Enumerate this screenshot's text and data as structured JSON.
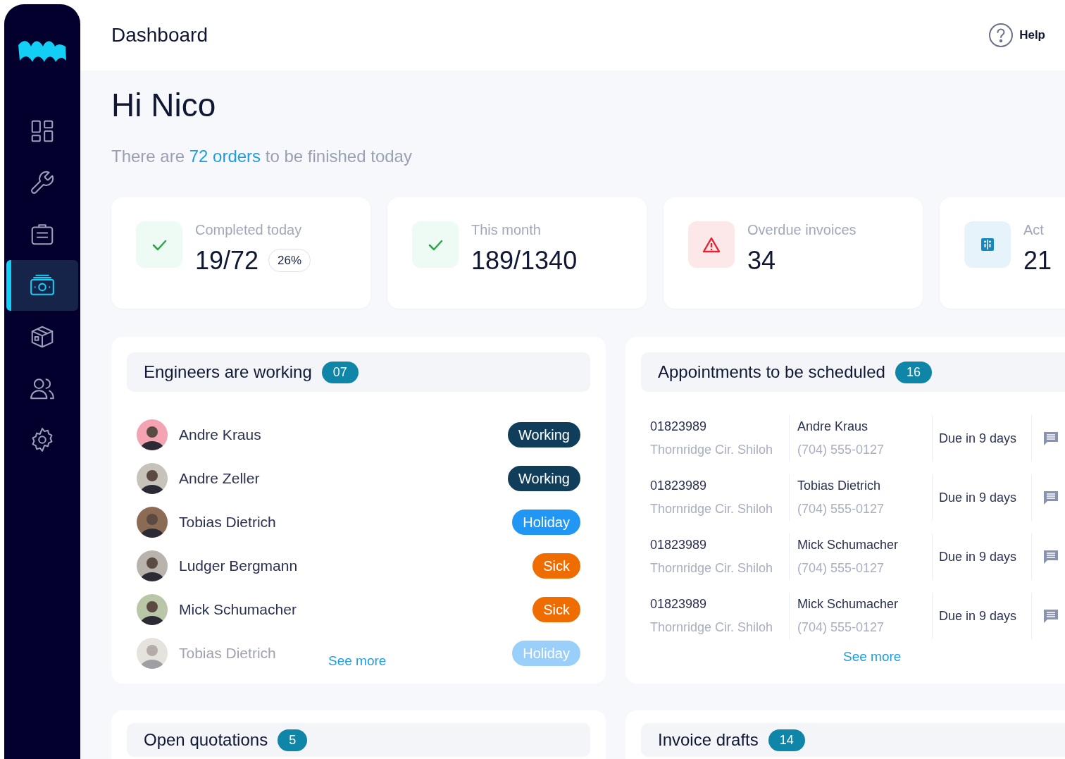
{
  "header": {
    "title": "Dashboard",
    "help": "Help"
  },
  "sidebar": {
    "items": [
      {
        "kind": "grid",
        "selected": false
      },
      {
        "kind": "wrench",
        "selected": false
      },
      {
        "kind": "briefcase",
        "selected": false
      },
      {
        "kind": "money",
        "selected": true
      },
      {
        "kind": "box",
        "selected": false
      },
      {
        "kind": "users",
        "selected": false
      },
      {
        "kind": "gear",
        "selected": false
      }
    ]
  },
  "greeting": {
    "title": "Hi Nico",
    "before": "There are",
    "link": "72 orders",
    "after": "to be finished today"
  },
  "stats": [
    {
      "kind": "check",
      "label": "Completed today",
      "value": "19/72",
      "badge": "26%"
    },
    {
      "kind": "check",
      "label": "This month",
      "value": "189/1340"
    },
    {
      "kind": "warning",
      "label": "Overdue invoices",
      "value": "34"
    },
    {
      "kind": "info",
      "label": "Act",
      "value": "21"
    }
  ],
  "engineers": {
    "title": "Engineers are working",
    "count": "07",
    "see_more": "See more",
    "rows": [
      {
        "name": "Andre Kraus",
        "status": "Working",
        "kind": "working",
        "faded": false
      },
      {
        "name": "Andre Zeller",
        "status": "Working",
        "kind": "working",
        "faded": false
      },
      {
        "name": "Tobias Dietrich",
        "status": "Holiday",
        "kind": "holiday",
        "faded": false
      },
      {
        "name": "Ludger Bergmann",
        "status": "Sick",
        "kind": "sick",
        "faded": false
      },
      {
        "name": "Mick Schumacher",
        "status": "Sick",
        "kind": "sick",
        "faded": false
      },
      {
        "name": "Tobias Dietrich",
        "status": "Holiday",
        "kind": "holiday",
        "faded": true
      }
    ]
  },
  "appointments": {
    "title": "Appointments to be scheduled",
    "count": "16",
    "see_more": "See more",
    "rows": [
      {
        "order": "01823989",
        "address": "Thornridge Cir. Shiloh",
        "name": "Andre Kraus",
        "phone": "(704) 555-0127",
        "due": "Due in 9 days"
      },
      {
        "order": "01823989",
        "address": "Thornridge Cir. Shiloh",
        "name": "Tobias Dietrich",
        "phone": "(704) 555-0127",
        "due": "Due in 9 days"
      },
      {
        "order": "01823989",
        "address": "Thornridge Cir. Shiloh",
        "name": "Mick Schumacher",
        "phone": "(704) 555-0127",
        "due": "Due in 9 days"
      },
      {
        "order": "01823989",
        "address": "Thornridge Cir. Shiloh",
        "name": "Mick Schumacher",
        "phone": "(704) 555-0127",
        "due": "Due in 9 days"
      }
    ]
  },
  "bottom_panels": [
    {
      "title": "Open quotations",
      "count": "5"
    },
    {
      "title": "Invoice drafts",
      "count": "14"
    }
  ]
}
